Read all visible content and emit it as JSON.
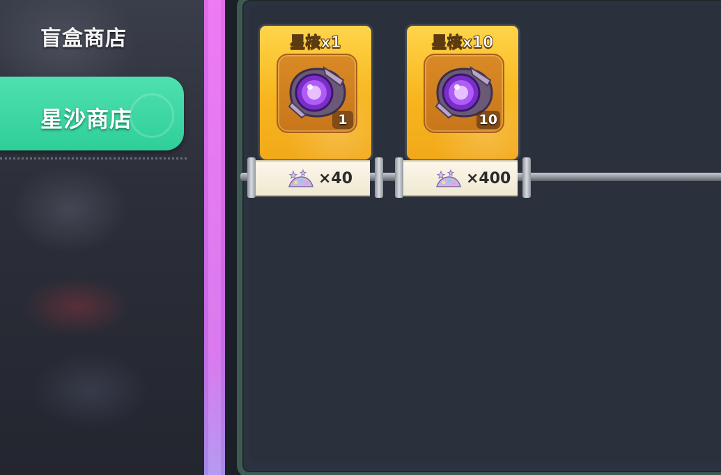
{
  "sidebar": {
    "tabs": [
      {
        "label": "盲盒商店",
        "active": false
      },
      {
        "label": "星沙商店",
        "active": true
      }
    ]
  },
  "shop": {
    "items": [
      {
        "name": "星核x1",
        "quantity": "1",
        "price": "×40",
        "currency_icon": "star-sand-icon",
        "item_icon": "star-core-icon"
      },
      {
        "name": "星核x10",
        "quantity": "10",
        "price": "×400",
        "currency_icon": "star-sand-icon",
        "item_icon": "star-core-icon"
      }
    ]
  },
  "colors": {
    "active_tab": "#2fcf98",
    "card_gold": "#f7b51e",
    "panel_bg": "#2d3240",
    "panel_border": "#3f5a52",
    "side_bar_pink": "#d97aee",
    "orb_purple": "#a24cf0"
  }
}
